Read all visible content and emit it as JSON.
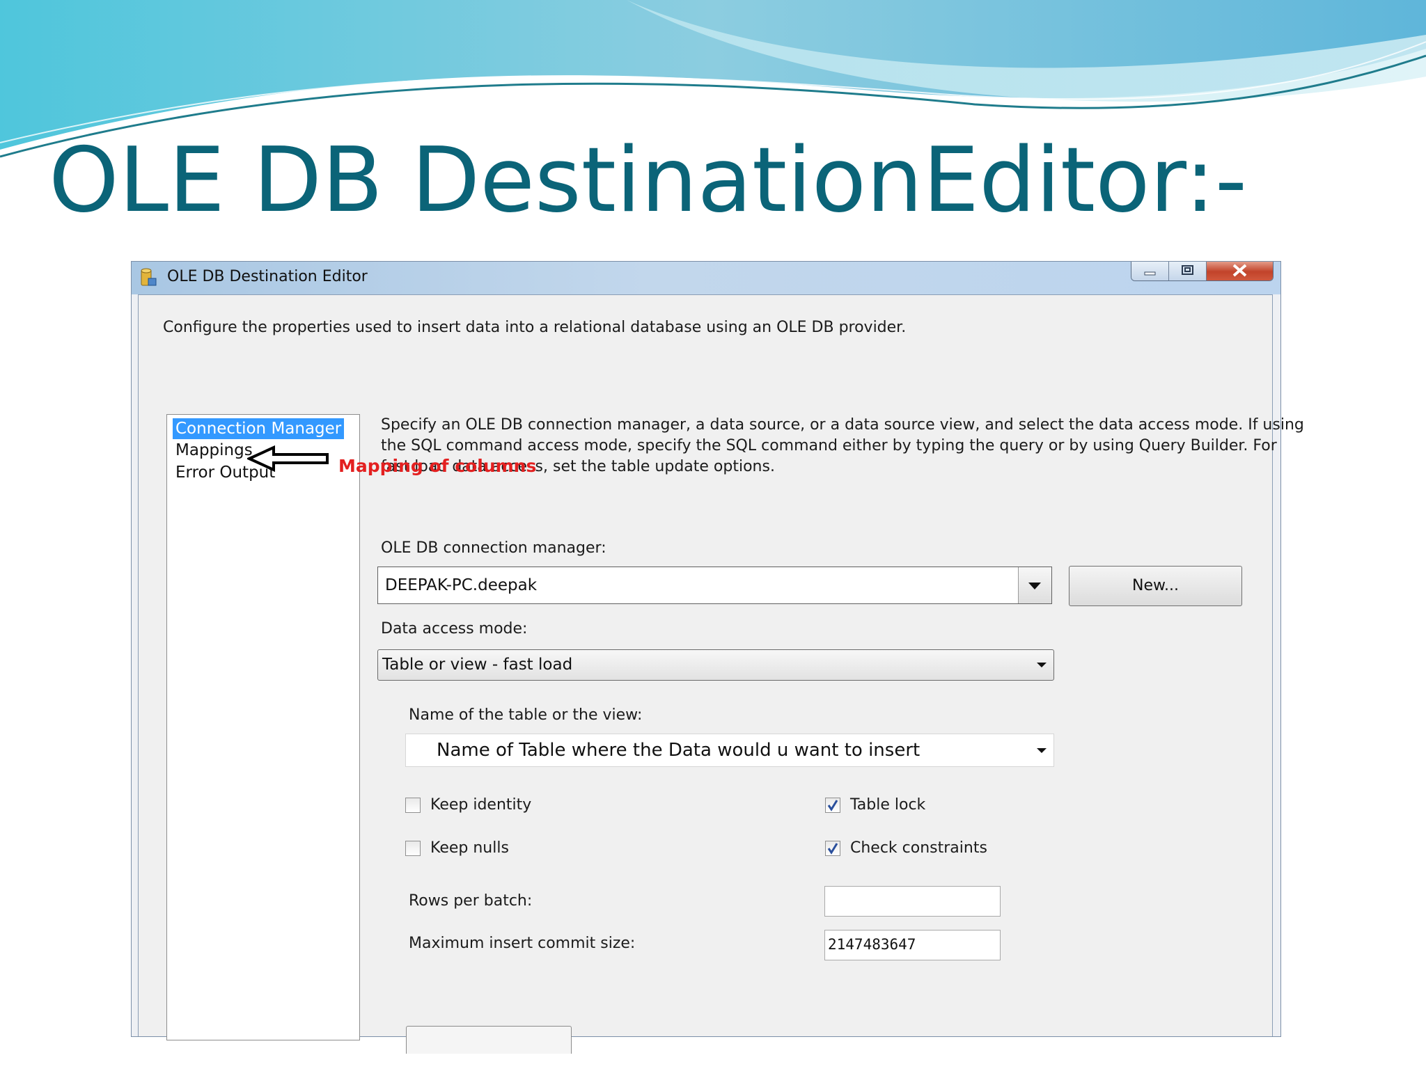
{
  "slide": {
    "title": "OLE DB DestinationEditor:-"
  },
  "window": {
    "title": "OLE DB Destination Editor",
    "header_description": "Configure the properties used to insert data into a relational database using an OLE DB provider."
  },
  "nav": {
    "items": [
      {
        "label": "Connection Manager",
        "selected": true
      },
      {
        "label": "Mappings",
        "selected": false
      },
      {
        "label": "Error Output",
        "selected": false
      }
    ]
  },
  "annotation": {
    "text": "Mapping of columns",
    "color": "#e32020"
  },
  "page": {
    "description_lines": [
      "Specify an OLE DB connection manager, a data source, or a data source view, and select the data access mode. If using",
      "the SQL command access mode, specify the SQL command either by typing the query or by using Query Builder. For",
      "fast load data access, set the table update options."
    ],
    "connection_manager_label": "OLE DB connection manager:",
    "connection_manager_value": "DEEPAK-PC.deepak",
    "new_button_label": "New...",
    "data_access_mode_label": "Data access mode:",
    "data_access_mode_value": "Table or view - fast load",
    "table_name_label": "Name of the table or the view:",
    "table_name_value": "Name of Table where the Data would u want to insert",
    "options": {
      "keep_identity": {
        "label": "Keep identity",
        "checked": false
      },
      "keep_nulls": {
        "label": "Keep nulls",
        "checked": false
      },
      "table_lock": {
        "label": "Table lock",
        "checked": true
      },
      "check_constraints": {
        "label": "Check constraints",
        "checked": true
      }
    },
    "rows_per_batch_label": "Rows per batch:",
    "rows_per_batch_value": "",
    "max_insert_commit_label": "Maximum insert commit size:",
    "max_insert_commit_value": "2147483647"
  },
  "colors": {
    "title": "#0b6478",
    "selection": "#3399ff",
    "annotation": "#e32020"
  },
  "icons": [
    "app-icon",
    "minimize-icon",
    "maximize-icon",
    "close-icon",
    "chevron-down-icon",
    "checkmark-icon",
    "arrow-left-icon"
  ]
}
